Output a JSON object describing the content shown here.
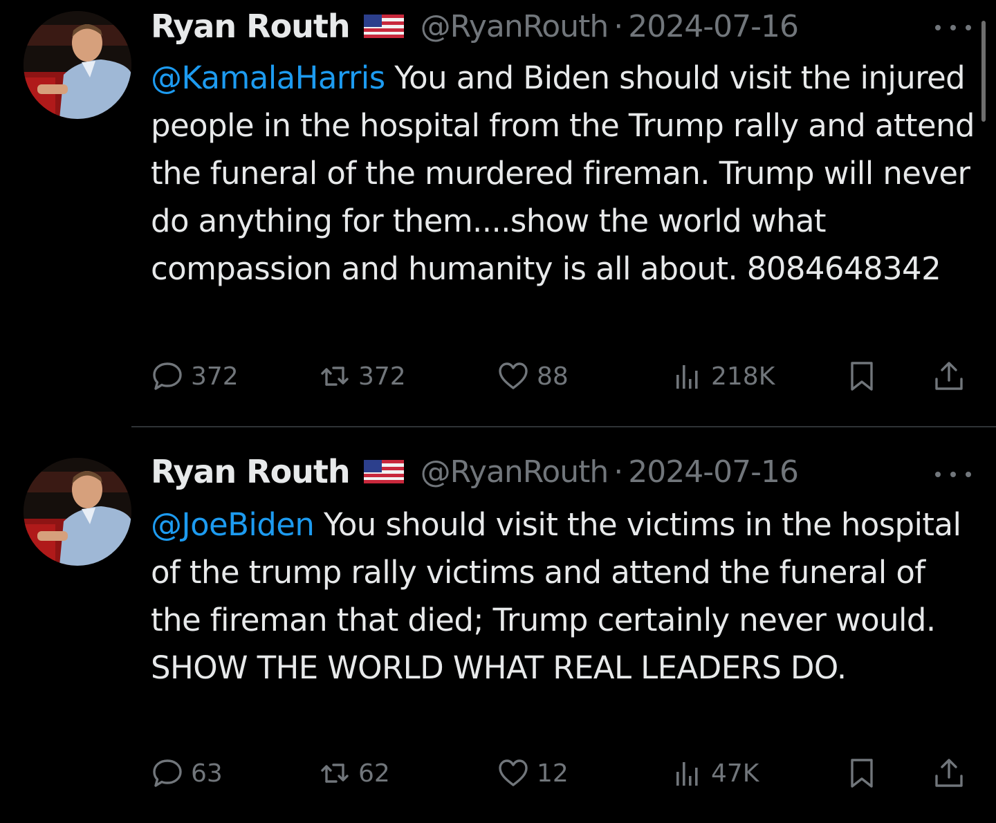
{
  "colors": {
    "background": "#000000",
    "text": "#e7e9ea",
    "muted": "#71767b",
    "mention": "#1d9bf0",
    "divider": "#2f3336"
  },
  "icons": {
    "reply": "speech-bubble-icon",
    "retweet": "retweet-arrows-icon",
    "like": "heart-icon",
    "views": "bar-chart-icon",
    "bookmark": "bookmark-icon",
    "share": "share-upload-icon",
    "more": "ellipsis-icon",
    "flag": "us-flag-emoji"
  },
  "tweets": [
    {
      "display_name": "Ryan Routh",
      "handle": "@RyanRouth",
      "separator": "·",
      "date": "2024-07-16",
      "mention": "@KamalaHarris",
      "text": " You and Biden should visit the injured people in the hospital from the Trump rally and attend the funeral of the murdered fireman. Trump will never do anything for them....show the world what compassion and humanity is all about. 8084648342",
      "replies": "372",
      "retweets": "372",
      "likes": "88",
      "views": "218K"
    },
    {
      "display_name": "Ryan Routh",
      "handle": "@RyanRouth",
      "separator": "·",
      "date": "2024-07-16",
      "mention": "@JoeBiden",
      "text": " You should visit the victims in the hospital of the trump rally victims and attend the funeral of the fireman that died; Trump certainly never would. SHOW THE WORLD WHAT REAL LEADERS DO.",
      "replies": "63",
      "retweets": "62",
      "likes": "12",
      "views": "47K"
    }
  ]
}
